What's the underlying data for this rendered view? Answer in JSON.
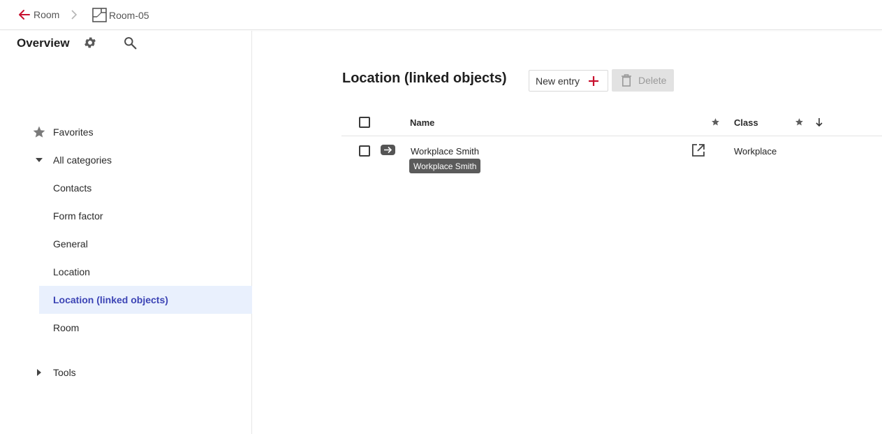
{
  "breadcrumb": {
    "back_label": "Room",
    "current_label": "Room-05"
  },
  "sidebar": {
    "title": "Overview",
    "favorites_label": "Favorites",
    "all_categories_label": "All categories",
    "items": [
      {
        "label": "Contacts"
      },
      {
        "label": "Form factor"
      },
      {
        "label": "General"
      },
      {
        "label": "Location"
      },
      {
        "label": "Location (linked objects)",
        "active": true
      },
      {
        "label": "Room"
      }
    ],
    "tools_label": "Tools"
  },
  "main": {
    "title": "Location (linked objects)",
    "new_entry_label": "New entry",
    "delete_label": "Delete",
    "table": {
      "columns": [
        "Name",
        "Class"
      ],
      "rows": [
        {
          "name": "Workplace Smith",
          "class": "Workplace"
        }
      ],
      "tooltip": "Workplace Smith"
    }
  },
  "colors": {
    "accent": "#c8102e",
    "active_bg": "#e9f0fd",
    "active_text": "#3c44b5"
  }
}
